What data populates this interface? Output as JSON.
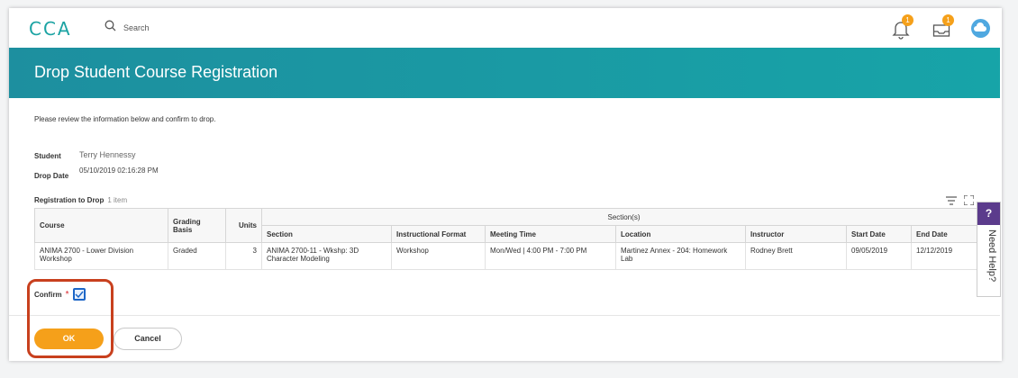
{
  "app": {
    "logo_text": "CCA",
    "search_label": "Search",
    "notifications_badge": "1",
    "inbox_badge": "1"
  },
  "page": {
    "title": "Drop Student Course Registration",
    "intro": "Please review the information below and confirm to drop."
  },
  "fields": {
    "student_label": "Student",
    "student_value": "Terry Hennessy",
    "drop_date_label": "Drop Date",
    "drop_date_value": "05/10/2019 02:16:28 PM"
  },
  "registration": {
    "title": "Registration to Drop",
    "count": "1 item",
    "group_header": "Section(s)",
    "columns": [
      "Course",
      "Grading Basis",
      "Units",
      "Section",
      "Instructional Format",
      "Meeting Time",
      "Location",
      "Instructor",
      "Start Date",
      "End Date"
    ],
    "row": [
      "ANIMA 2700 - Lower Division Workshop",
      "Graded",
      "3",
      "ANIMA 2700-11 - Wkshp: 3D Character Modeling",
      "Workshop",
      "Mon/Wed | 4:00 PM - 7:00 PM",
      "Martinez Annex - 204: Homework Lab",
      "Rodney Brett",
      "09/05/2019",
      "12/12/2019"
    ]
  },
  "confirm": {
    "label": "Confirm",
    "required_mark": "*",
    "checked": true
  },
  "buttons": {
    "ok": "OK",
    "cancel": "Cancel"
  },
  "help": {
    "q": "?",
    "label": "Need Help?"
  },
  "colors": {
    "accent": "#1ba3a3",
    "header": "#17a4a8",
    "ok": "#f5a01a",
    "highlight": "#c8401e",
    "help": "#5b3b8c"
  }
}
